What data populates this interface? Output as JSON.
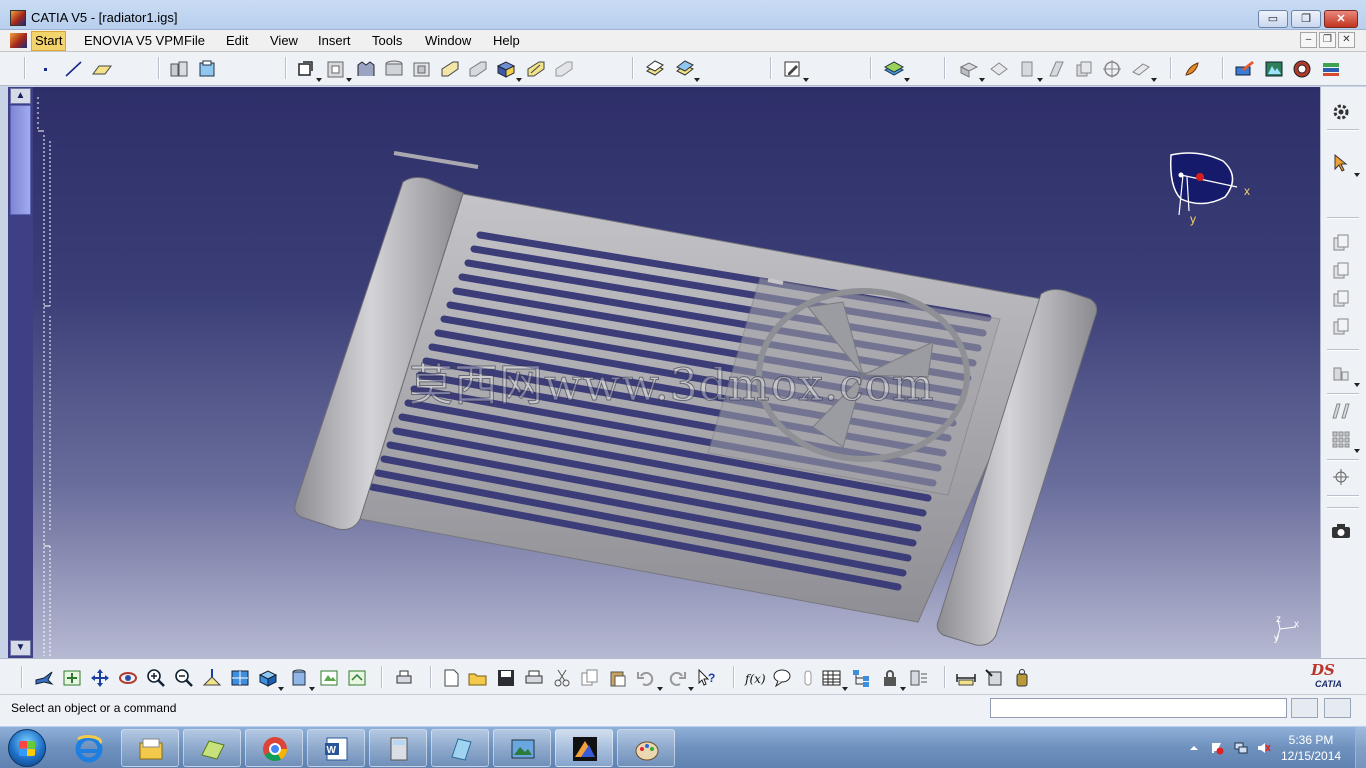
{
  "window": {
    "title": "CATIA V5 - [radiator1.igs]",
    "controls": {
      "minimize": "▭",
      "maximize": "❐",
      "close": "✕"
    }
  },
  "menu": {
    "items": [
      "Start",
      "ENOVIA V5 VPM",
      "File",
      "Edit",
      "View",
      "Insert",
      "Tools",
      "Window",
      "Help"
    ],
    "active": "Start",
    "doc_controls": [
      "–",
      "❐",
      "✕"
    ]
  },
  "toolbars": {
    "top_icons": [
      "point-icon",
      "line-icon",
      "plane-icon",
      "assembly-icon",
      "section-icon",
      "sketch-icon",
      "pad-icon",
      "pocket-icon",
      "shaft-icon",
      "groove-icon",
      "fillet-icon",
      "chamfer-icon",
      "draft-icon",
      "shell-icon",
      "thickness-icon",
      "boolean-icon",
      "union-icon",
      "annotation-icon",
      "sheet-icon",
      "material-icon",
      "surface-icon",
      "shape-icon",
      "shape-icon-2",
      "shape-icon-3",
      "shape-icon-4",
      "target-icon",
      "shape-icon-5",
      "hand-paint-icon",
      "catalog-icon",
      "knowledge-icon",
      "rendering-icon",
      "analysis-icon"
    ],
    "right_icons": [
      "gear-icon",
      "select-arrow-icon",
      "copy-icon",
      "paste-icon",
      "duplicate-icon",
      "pattern-icon",
      "scale-icon",
      "mirror-icon",
      "array-icon",
      "compass-icon",
      "camera-icon"
    ],
    "bottom_icons": [
      "fly-mode-icon",
      "fit-all-icon",
      "pan-icon",
      "rotate-icon",
      "zoom-in-icon",
      "zoom-out-icon",
      "normal-view-icon",
      "iso-view-icon",
      "views-icon",
      "render-style-icon",
      "hide-show-icon",
      "swap-space-icon",
      "print-icon",
      "new-icon",
      "open-icon",
      "save-icon",
      "print-icon-2",
      "cut-icon",
      "copy-icon-2",
      "paste-icon-2",
      "undo-icon",
      "redo-icon",
      "whats-this-icon",
      "formula-icon",
      "comment-icon",
      "measure-icon",
      "table-icon",
      "tree-icon",
      "lock-icon",
      "properties-icon",
      "measure-between-icon",
      "measure-item-icon",
      "mass-icon"
    ]
  },
  "viewport": {
    "watermark": "莫西网www.3dmox.com",
    "compass": {
      "x_label": "x",
      "y_label": "y"
    },
    "axis": {
      "x": "x",
      "y": "y",
      "z": "z"
    }
  },
  "logo": {
    "mark": "DS",
    "text": "CATIA"
  },
  "status": {
    "message": "Select an object or a command",
    "input_value": ""
  },
  "taskbar": {
    "apps": [
      "internet-explorer-icon",
      "file-explorer-icon",
      "folder-icon",
      "chrome-icon",
      "word-icon",
      "calculator-icon",
      "notepad-icon",
      "image-viewer-icon",
      "catia-icon",
      "paint-icon"
    ],
    "active_app": "catia-icon",
    "time": "5:36 PM",
    "date": "12/15/2014"
  },
  "colors": {
    "viewport_top": "#2e2f6a",
    "viewport_bottom": "#b6b9d2",
    "model": "#a9a9ad",
    "accent": "#f3d36b"
  }
}
